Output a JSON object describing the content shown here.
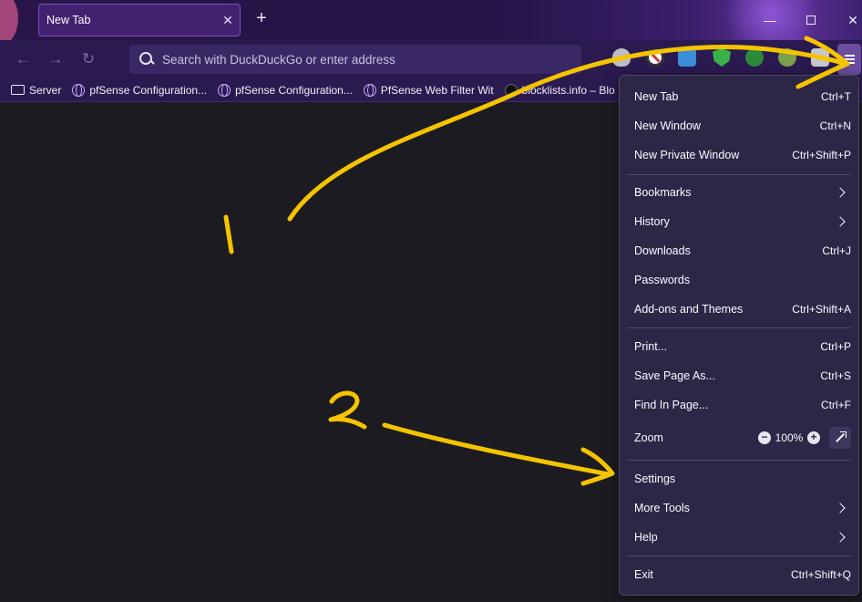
{
  "tabs": [
    {
      "title": "New Tab",
      "close_glyph": "✕"
    }
  ],
  "tabstrip": {
    "new_tab_glyph": "+"
  },
  "window_controls": {
    "minimize": "—",
    "close": "✕"
  },
  "nav": {
    "back_glyph": "←",
    "forward_glyph": "→",
    "reload_glyph": "↻",
    "search_placeholder": "Search with DuckDuckGo or enter address"
  },
  "extensions": [
    "privacy-badger-icon",
    "block-icon",
    "tab-icon",
    "shield-check-icon",
    "leaf-icon",
    "frog-icon",
    "extension-icon"
  ],
  "bookmarks": [
    {
      "label": "Server",
      "icon": "folder-icon"
    },
    {
      "label": "pfSense Configuration...",
      "icon": "globe-icon"
    },
    {
      "label": "pfSense Configuration...",
      "icon": "globe-icon"
    },
    {
      "label": "PfSense Web Filter Wit",
      "icon": "globe-icon"
    },
    {
      "label": "blocklists.info – Blo",
      "icon": "blocklists-icon"
    }
  ],
  "menu": {
    "new_tab": {
      "label": "New Tab",
      "shortcut": "Ctrl+T"
    },
    "new_window": {
      "label": "New Window",
      "shortcut": "Ctrl+N"
    },
    "new_private_window": {
      "label": "New Private Window",
      "shortcut": "Ctrl+Shift+P"
    },
    "bookmarks": {
      "label": "Bookmarks"
    },
    "history": {
      "label": "History"
    },
    "downloads": {
      "label": "Downloads",
      "shortcut": "Ctrl+J"
    },
    "passwords": {
      "label": "Passwords"
    },
    "addons": {
      "label": "Add-ons and Themes",
      "shortcut": "Ctrl+Shift+A"
    },
    "print": {
      "label": "Print...",
      "shortcut": "Ctrl+P"
    },
    "save_page": {
      "label": "Save Page As...",
      "shortcut": "Ctrl+S"
    },
    "find": {
      "label": "Find In Page...",
      "shortcut": "Ctrl+F"
    },
    "zoom": {
      "label": "Zoom",
      "minus": "−",
      "value": "100%",
      "plus": "+"
    },
    "settings": {
      "label": "Settings"
    },
    "more_tools": {
      "label": "More Tools"
    },
    "help": {
      "label": "Help"
    },
    "exit": {
      "label": "Exit",
      "shortcut": "Ctrl+Shift+Q"
    }
  },
  "annotations": {
    "label_1": "1",
    "label_2": "2",
    "color": "#f5c400"
  },
  "colors": {
    "accent": "#6b4c9e",
    "toolbar": "#2b1a50",
    "content_bg": "#1c1b22",
    "menu_bg": "#2c2647"
  }
}
